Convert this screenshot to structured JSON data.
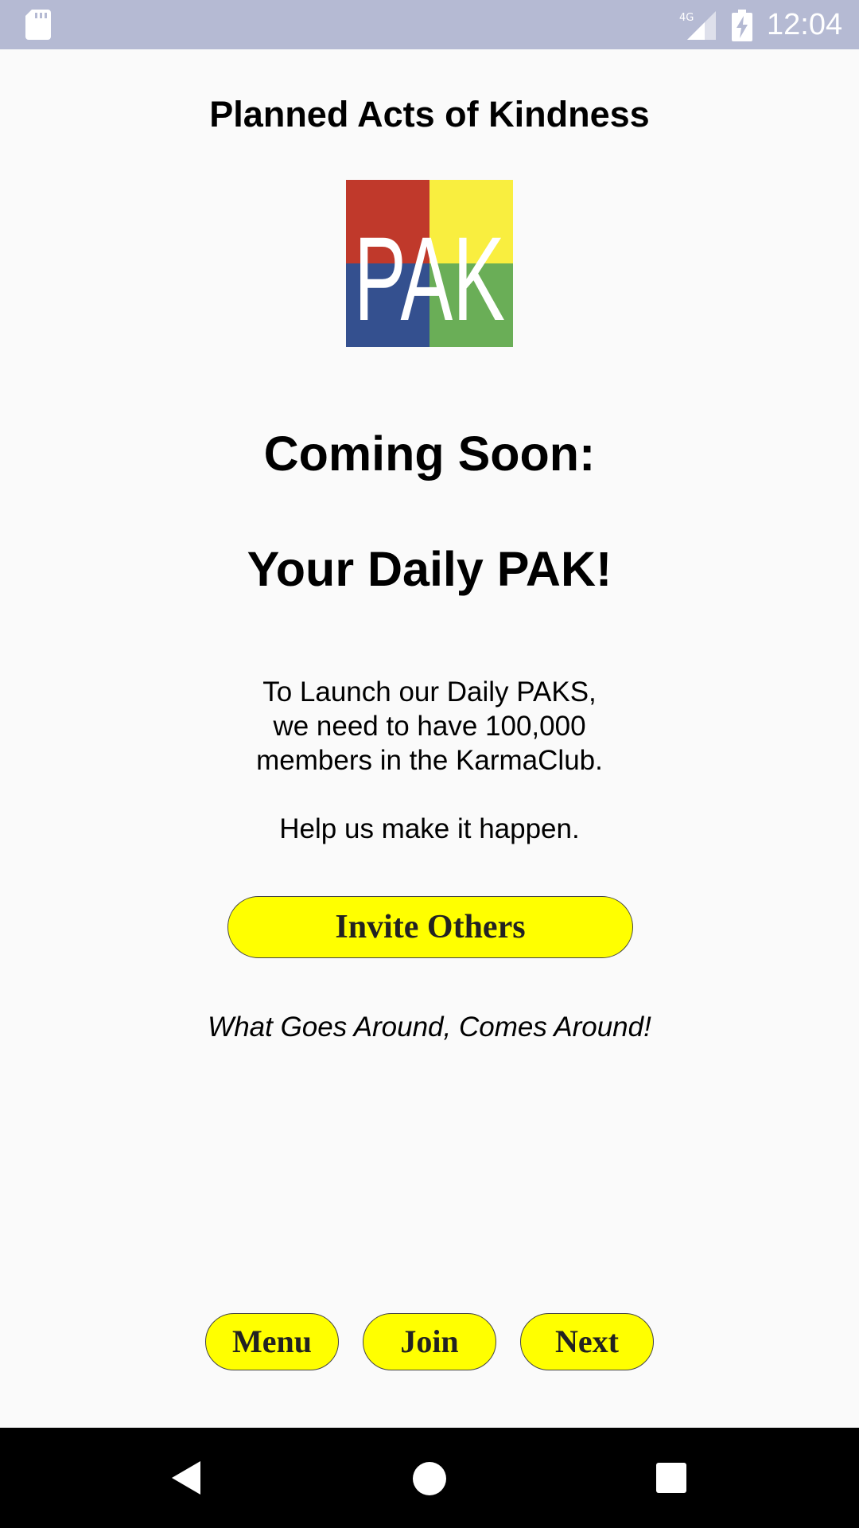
{
  "status_bar": {
    "time": "12:04",
    "network_label": "4G",
    "icons": [
      "sd-card-icon",
      "signal-icon",
      "battery-charging-icon"
    ]
  },
  "header": {
    "title": "Planned Acts of Kindness"
  },
  "logo": {
    "text": "PAK",
    "colors": [
      "#c0392b",
      "#f9ee3f",
      "#34508f",
      "#6aae57"
    ]
  },
  "main": {
    "heading_1": "Coming Soon:",
    "heading_2": "Your Daily PAK!",
    "body_lines": [
      "To Launch our Daily PAKS,",
      "we need to have 100,000",
      "members in the KarmaClub.",
      "",
      "Help us make it happen."
    ],
    "invite_button_label": "Invite Others",
    "tagline": "What Goes Around, Comes Around!"
  },
  "bottom_nav": {
    "menu_label": "Menu",
    "join_label": "Join",
    "next_label": "Next"
  },
  "system_nav": {
    "icons": [
      "back-icon",
      "home-icon",
      "recents-icon"
    ]
  },
  "colors": {
    "status_bar_bg": "#b5bad3",
    "button_yellow": "#ffff00",
    "page_bg": "#fafafa"
  }
}
